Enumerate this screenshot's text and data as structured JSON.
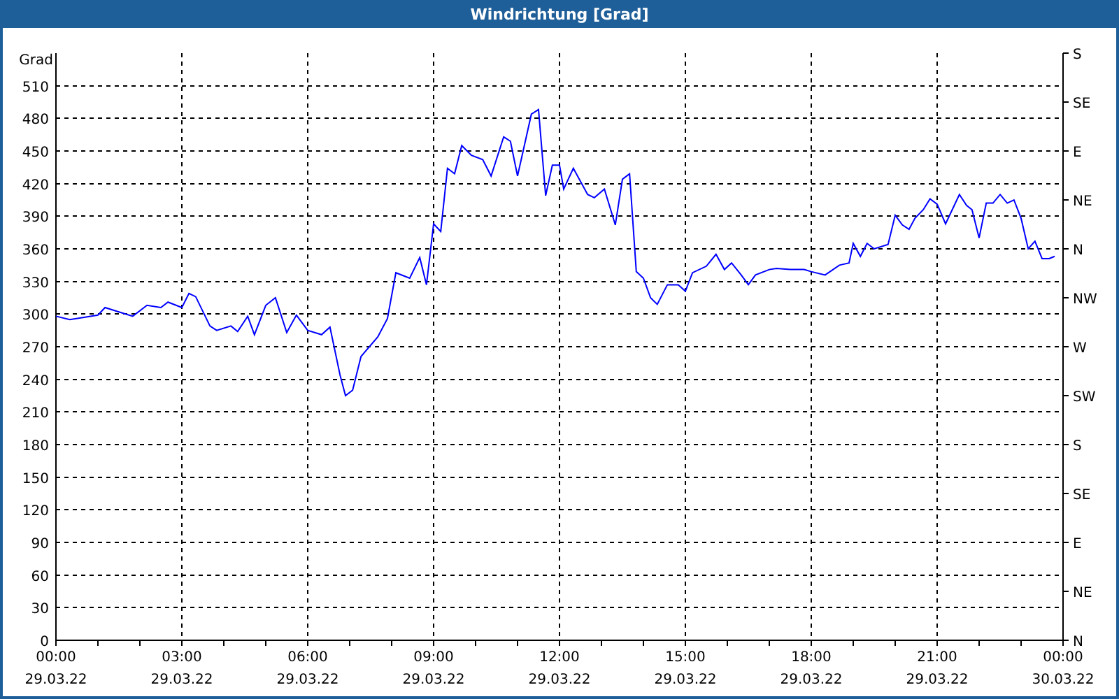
{
  "window": {
    "title": "Windrichtung [Grad]"
  },
  "chart": {
    "x_date_labels": [
      "29.03.22",
      "29.03.22",
      "29.03.22",
      "29.03.22",
      "29.03.22",
      "29.03.22",
      "29.03.22",
      "29.03.22",
      "30.03.22"
    ],
    "right_axis_labels": [
      "S",
      "SE",
      "E",
      "NE",
      "N",
      "NW",
      "W",
      "SW",
      "S",
      "SE",
      "E",
      "NE",
      "N"
    ],
    "chart_data": {
      "type": "line",
      "grid": true,
      "ylabel": "Grad",
      "xlim": [
        0,
        24
      ],
      "ylim": [
        0,
        540
      ],
      "xticks": [
        {
          "value": 0,
          "label": "00:00"
        },
        {
          "value": 3,
          "label": "03:00"
        },
        {
          "value": 6,
          "label": "06:00"
        },
        {
          "value": 9,
          "label": "09:00"
        },
        {
          "value": 12,
          "label": "12:00"
        },
        {
          "value": 15,
          "label": "15:00"
        },
        {
          "value": 18,
          "label": "18:00"
        },
        {
          "value": 21,
          "label": "21:00"
        },
        {
          "value": 24,
          "label": "00:00"
        }
      ],
      "yticks": [
        {
          "value": 0,
          "label": "0"
        },
        {
          "value": 30,
          "label": "30"
        },
        {
          "value": 60,
          "label": "60"
        },
        {
          "value": 90,
          "label": "90"
        },
        {
          "value": 120,
          "label": "120"
        },
        {
          "value": 150,
          "label": "150"
        },
        {
          "value": 180,
          "label": "180"
        },
        {
          "value": 210,
          "label": "210"
        },
        {
          "value": 240,
          "label": "240"
        },
        {
          "value": 270,
          "label": "270"
        },
        {
          "value": 300,
          "label": "300"
        },
        {
          "value": 330,
          "label": "330"
        },
        {
          "value": 360,
          "label": "360"
        },
        {
          "value": 390,
          "label": "390"
        },
        {
          "value": 420,
          "label": "420"
        },
        {
          "value": 450,
          "label": "450"
        },
        {
          "value": 480,
          "label": "480"
        },
        {
          "value": 510,
          "label": "510"
        }
      ],
      "x": [
        0,
        0.33,
        0.67,
        1.0,
        1.17,
        1.5,
        1.83,
        2.17,
        2.5,
        2.67,
        3.0,
        3.17,
        3.33,
        3.67,
        3.83,
        4.17,
        4.33,
        4.57,
        4.73,
        5.0,
        5.23,
        5.5,
        5.73,
        6.0,
        6.33,
        6.53,
        6.77,
        6.9,
        7.07,
        7.27,
        7.67,
        7.9,
        8.1,
        8.43,
        8.67,
        8.83,
        9.0,
        9.17,
        9.33,
        9.5,
        9.67,
        9.9,
        10.17,
        10.37,
        10.67,
        10.83,
        11.0,
        11.33,
        11.5,
        11.67,
        11.83,
        12.0,
        12.1,
        12.33,
        12.67,
        12.83,
        13.07,
        13.33,
        13.5,
        13.67,
        13.83,
        14.0,
        14.17,
        14.33,
        14.57,
        14.83,
        15.0,
        15.17,
        15.5,
        15.73,
        15.93,
        16.1,
        16.33,
        16.5,
        16.67,
        17.0,
        17.17,
        17.5,
        17.83,
        18.0,
        18.33,
        18.67,
        18.9,
        19.0,
        19.17,
        19.33,
        19.5,
        19.83,
        20.0,
        20.17,
        20.33,
        20.47,
        20.67,
        20.83,
        21.0,
        21.2,
        21.53,
        21.7,
        21.83,
        22.0,
        22.17,
        22.33,
        22.5,
        22.67,
        22.83,
        23.0,
        23.17,
        23.33,
        23.5,
        23.67,
        23.8
      ],
      "series": [
        {
          "color": "#0000ff",
          "values": [
            298,
            295,
            297,
            299,
            306,
            302,
            298,
            308,
            306,
            311,
            306,
            319,
            316,
            289,
            285,
            289,
            284,
            298,
            281,
            308,
            315,
            283,
            299,
            285,
            281,
            288,
            244,
            225,
            230,
            261,
            279,
            296,
            338,
            333,
            352,
            327,
            383,
            376,
            434,
            429,
            455,
            446,
            442,
            427,
            463,
            459,
            427,
            484,
            488,
            409,
            437,
            437,
            415,
            434,
            410,
            407,
            415,
            382,
            424,
            429,
            339,
            333,
            315,
            309,
            327,
            327,
            321,
            338,
            344,
            355,
            341,
            347,
            336,
            327,
            336,
            341,
            342,
            341,
            341,
            339,
            336,
            345,
            347,
            365,
            353,
            365,
            360,
            364,
            391,
            382,
            378,
            388,
            396,
            406,
            401,
            383,
            410,
            400,
            396,
            370,
            402,
            402,
            410,
            402,
            405,
            388,
            360,
            367,
            351,
            351,
            353
          ]
        }
      ]
    }
  }
}
